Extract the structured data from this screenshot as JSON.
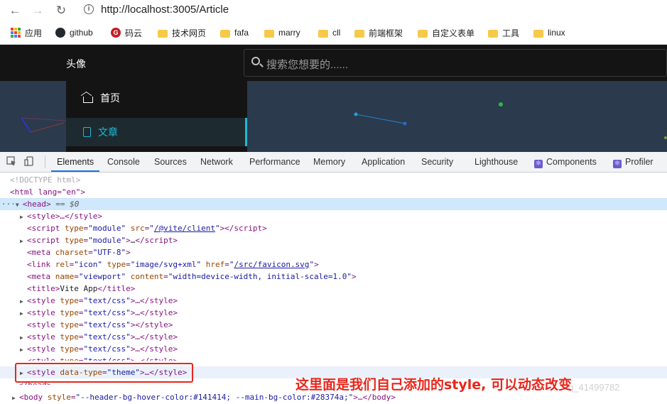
{
  "browser": {
    "url": "http://localhost:3005/Article",
    "bookmarks": [
      {
        "label": "应用",
        "icon": "apps-icon"
      },
      {
        "label": "github",
        "icon": "github-icon"
      },
      {
        "label": "码云",
        "icon": "gitee-icon"
      },
      {
        "label": "技术网页",
        "icon": "folder-icon"
      },
      {
        "label": "fafa",
        "icon": "folder-icon"
      },
      {
        "label": "marry",
        "icon": "folder-icon"
      },
      {
        "label": "cll",
        "icon": "folder-icon"
      },
      {
        "label": "前端框架",
        "icon": "folder-icon"
      },
      {
        "label": "自定义表单",
        "icon": "folder-icon"
      },
      {
        "label": "工具",
        "icon": "folder-icon"
      },
      {
        "label": "linux",
        "icon": "folder-icon"
      }
    ]
  },
  "app": {
    "avatar_label": "头像",
    "search_placeholder": "搜索您想要的......",
    "menu": [
      {
        "label": "首页",
        "icon": "home-icon"
      },
      {
        "label": "文章",
        "icon": "document-icon",
        "active": true
      }
    ],
    "accent_color": "#1fb8d6",
    "header_bg": "#141414",
    "main_bg": "#2b3a4c"
  },
  "devtools": {
    "tabs": [
      "Elements",
      "Console",
      "Sources",
      "Network",
      "Performance",
      "Memory",
      "Application",
      "Security",
      "Lighthouse",
      "Components",
      "Profiler"
    ],
    "active_tab": "Elements",
    "dom": {
      "doctype": "<!DOCTYPE html>",
      "html_open": "<html lang=\"en\">",
      "head_marker": "== $0",
      "lines": {
        "style1": "<style>…</style>",
        "script1_src": "/@vite/client",
        "script2": "…",
        "meta_charset": "UTF-8",
        "link_type": "image/svg+xml",
        "link_href": "/src/favicon.svg",
        "meta_name": "viewport",
        "meta_content": "width=device-width, initial-scale=1.0",
        "title": "Vite App",
        "css_type": "text/css",
        "theme_type": "theme",
        "body_style": "--header-bg-hover-color:#141414; --main-bg-color:#28374a;"
      }
    }
  },
  "annotation": "这里面是我们自己添加的style, 可以动态改变",
  "watermark": "q_41499782"
}
